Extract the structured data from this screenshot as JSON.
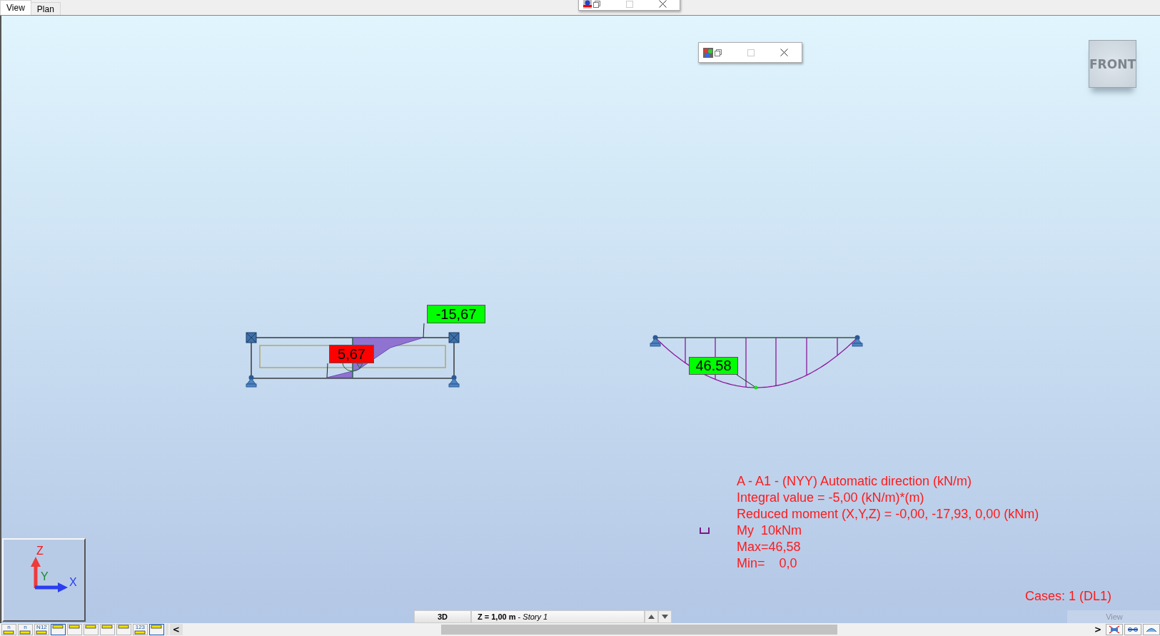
{
  "tabs": [
    {
      "label": "View",
      "selected": true
    },
    {
      "label": "Plan",
      "selected": false
    }
  ],
  "view_cube": {
    "label": "FRONT"
  },
  "diagram_labels": [
    {
      "text": "-15,67",
      "color": "#00ff00"
    },
    {
      "text": "5,67",
      "color": "#ff0000"
    },
    {
      "text": "46.58",
      "color": "#00ff00"
    }
  ],
  "legend_lines": [
    {
      "kind": "text",
      "text": "A - A1 - (NYY) Automatic direction (kN/m)"
    },
    {
      "kind": "text",
      "text": "Integral value = -5,00 (kN/m)*(m)"
    },
    {
      "kind": "text",
      "text": "Reduced moment (X,Y,Z) = -0,00, -17,93, 0,00 (kNm)"
    },
    {
      "kind": "symbol",
      "text": "My  10kNm"
    },
    {
      "kind": "text",
      "text": "Max=46,58"
    },
    {
      "kind": "text",
      "text": "Min=    0,0"
    }
  ],
  "cases": "Cases: 1 (DL1)",
  "axes": {
    "z": "Z",
    "y": "Y",
    "x": "X"
  },
  "view_mode_tab": "3D",
  "level_field": "**Z = 1,00 m** - *Story 1*",
  "view_button": "View",
  "toolbar": [
    {
      "glyph": "n",
      "selected": false
    },
    {
      "glyph": "n",
      "selected": false
    },
    {
      "glyph": "N12",
      "selected": false
    },
    {
      "selected": true
    },
    {
      "selected": false
    },
    {
      "selected": false
    },
    {
      "selected": false
    },
    {
      "selected": false
    },
    {
      "glyph": "123",
      "selected": false
    },
    {
      "selected": true
    }
  ],
  "scroll_left": "<",
  "scroll_right": ">"
}
